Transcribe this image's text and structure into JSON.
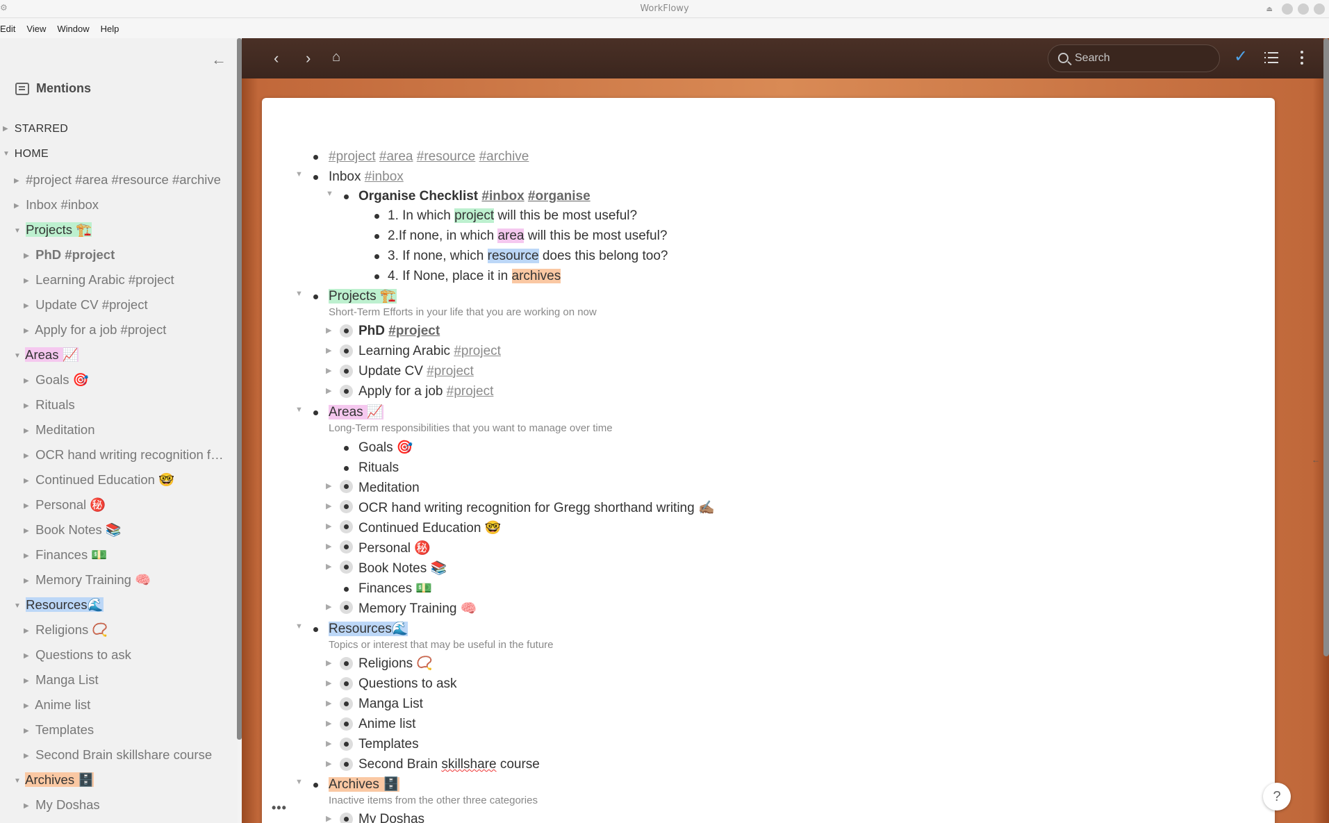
{
  "window": {
    "title": "WorkFlowy"
  },
  "menu": [
    "Edit",
    "View",
    "Window",
    "Help"
  ],
  "sidebar": {
    "mentions_label": "Mentions",
    "starred_label": "STARRED",
    "home_label": "HOME",
    "items": [
      {
        "label": "#project #area #resource #archive"
      },
      {
        "label": "Inbox #inbox"
      },
      {
        "label": "Projects 🏗️"
      },
      {
        "label": "PhD #project"
      },
      {
        "label": "Learning Arabic #project"
      },
      {
        "label": "Update CV #project"
      },
      {
        "label": "Apply for a job #project"
      },
      {
        "label": "Areas 📈"
      },
      {
        "label": "Goals 🎯"
      },
      {
        "label": "Rituals"
      },
      {
        "label": "Meditation"
      },
      {
        "label": "OCR hand writing recognition f…"
      },
      {
        "label": "Continued Education 🤓"
      },
      {
        "label": "Personal ㊙️"
      },
      {
        "label": "Book Notes 📚"
      },
      {
        "label": "Finances 💵"
      },
      {
        "label": "Memory Training 🧠"
      },
      {
        "label": "Resources🌊"
      },
      {
        "label": "Religions 📿"
      },
      {
        "label": "Questions to ask"
      },
      {
        "label": "Manga List"
      },
      {
        "label": "Anime list"
      },
      {
        "label": "Templates"
      },
      {
        "label": "Second Brain skillshare course"
      },
      {
        "label": "Archives 🗄️"
      },
      {
        "label": "My Doshas"
      }
    ]
  },
  "toolbar": {
    "search_placeholder": "Search"
  },
  "outline": {
    "top_tags": {
      "t1": "#project",
      "t2": "#area",
      "t3": "#resource",
      "t4": "#archive"
    },
    "inbox": {
      "label": "Inbox",
      "tag": "#inbox"
    },
    "checklist": {
      "label": "Organise Checklist",
      "tag1": "#inbox",
      "tag2": "#organise"
    },
    "q1": {
      "pre": "1. In which ",
      "hl": "project",
      "post": " will this be most useful?"
    },
    "q2": {
      "pre": "2.If none, in which ",
      "hl": "area",
      "post": " will this be most useful?"
    },
    "q3": {
      "pre": "3. If none, which ",
      "hl": "resource",
      "post": " does this belong too?"
    },
    "q4": {
      "pre": "4. If None, place it in ",
      "hl": "archives"
    },
    "projects": {
      "label": "Projects 🏗️",
      "note": "Short-Term Efforts in your life that you are working on now"
    },
    "proj_items": [
      {
        "label": "PhD",
        "tag": "#project"
      },
      {
        "label": "Learning Arabic",
        "tag": "#project"
      },
      {
        "label": "Update CV",
        "tag": "#project"
      },
      {
        "label": "Apply for a job",
        "tag": "#project"
      }
    ],
    "areas": {
      "label": "Areas 📈",
      "note": "Long-Term responsibilities that you want to manage over time"
    },
    "area_items": [
      {
        "label": "Goals 🎯"
      },
      {
        "label": "Rituals"
      },
      {
        "label": "Meditation"
      },
      {
        "label": "OCR hand writing recognition for Gregg shorthand writing ✍🏽"
      },
      {
        "label": "Continued Education 🤓"
      },
      {
        "label": "Personal ㊙️"
      },
      {
        "label": "Book Notes 📚"
      },
      {
        "label": "Finances 💵"
      },
      {
        "label": "Memory Training 🧠"
      }
    ],
    "resources": {
      "label": "Resources🌊",
      "note": "Topics or interest that may be useful in the future"
    },
    "res_items": [
      {
        "label": "Religions 📿"
      },
      {
        "label": "Questions to ask"
      },
      {
        "label": "Manga List"
      },
      {
        "label": "Anime list"
      },
      {
        "label": "Templates"
      },
      {
        "pre": "Second Brain ",
        "squiggle": "skillshare",
        "post": " course"
      }
    ],
    "archives": {
      "label": "Archives 🗄️",
      "note": "Inactive items from the other three categories"
    },
    "arch_items": [
      {
        "label": "My Doshas"
      }
    ]
  },
  "help_label": "?",
  "colors": {
    "project": "#bdf0cf",
    "area": "#f5c8ef",
    "resource": "#bcd7f7",
    "archive": "#fac8a3",
    "check": "#4fa3e8"
  }
}
